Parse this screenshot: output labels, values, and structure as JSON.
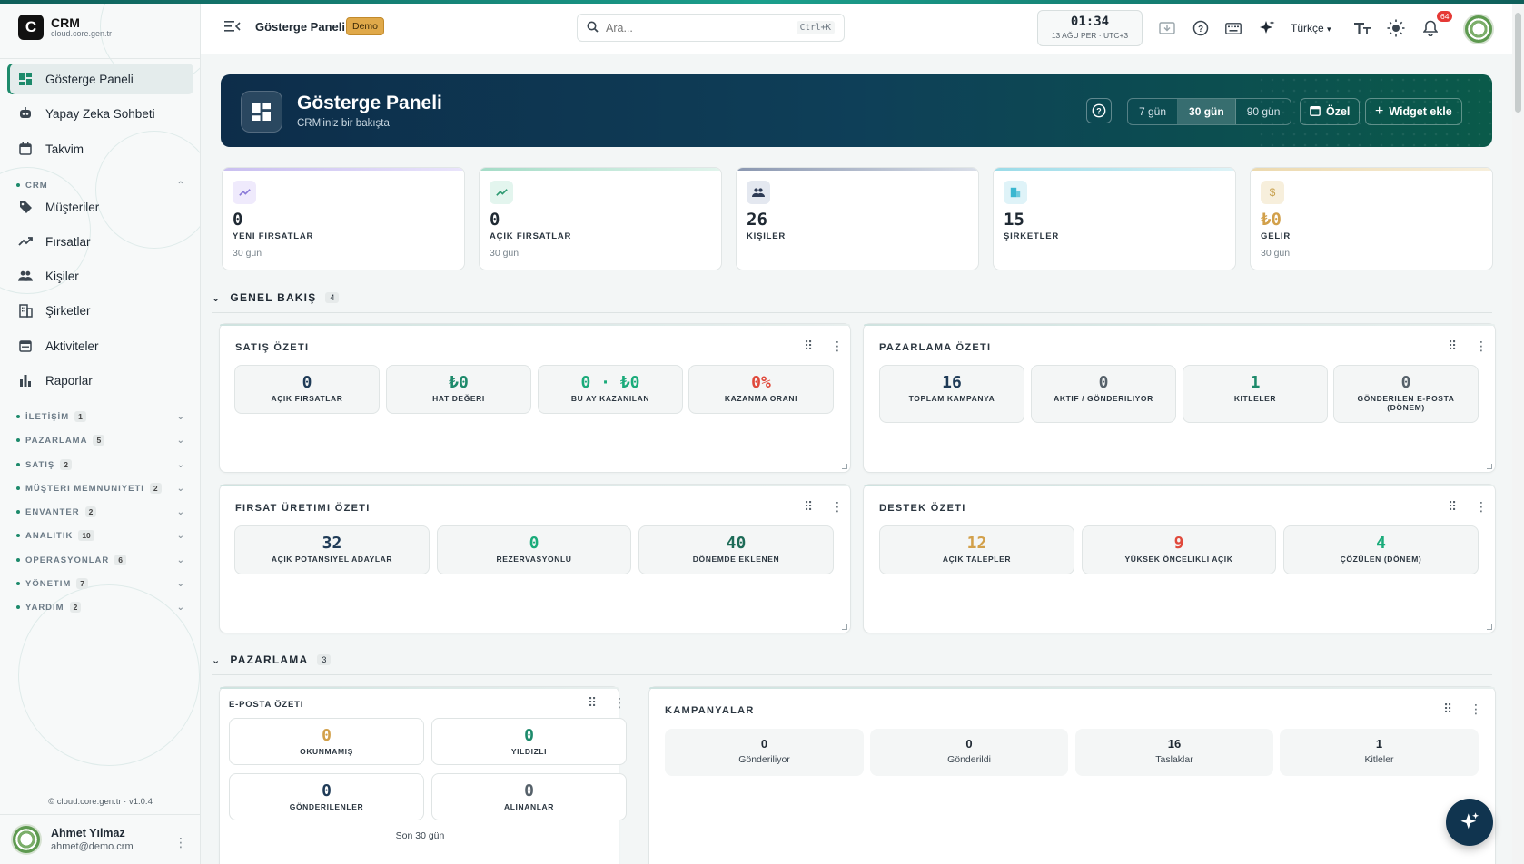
{
  "brand": {
    "title": "CRM",
    "subtitle": "cloud.core.gen.tr",
    "logo_letter": "C"
  },
  "sidebar": {
    "items": [
      {
        "label": "Gösterge Paneli",
        "icon": "dashboard-icon",
        "active": true
      },
      {
        "label": "Yapay Zeka Sohbeti",
        "icon": "robot-icon"
      },
      {
        "label": "Takvim",
        "icon": "calendar-icon"
      }
    ],
    "crm_group": {
      "label": "CRM"
    },
    "crm_items": [
      {
        "label": "Müşteriler",
        "icon": "tag-icon"
      },
      {
        "label": "Fırsatlar",
        "icon": "trend-icon"
      },
      {
        "label": "Kişiler",
        "icon": "people-icon"
      },
      {
        "label": "Şirketler",
        "icon": "building-icon"
      },
      {
        "label": "Aktiviteler",
        "icon": "calendar-check-icon"
      },
      {
        "label": "Raporlar",
        "icon": "bar-chart-icon"
      }
    ],
    "groups": [
      {
        "label": "İLETİŞİM",
        "count": "1"
      },
      {
        "label": "PAZARLAMA",
        "count": "5"
      },
      {
        "label": "SATIŞ",
        "count": "2"
      },
      {
        "label": "MÜŞTERI MEMNUNIYETI",
        "count": "2"
      },
      {
        "label": "ENVANTER",
        "count": "2"
      },
      {
        "label": "ANALITIK",
        "count": "10"
      },
      {
        "label": "OPERASYONLAR",
        "count": "6"
      },
      {
        "label": "YÖNETIM",
        "count": "7"
      },
      {
        "label": "YARDIM",
        "count": "2"
      }
    ],
    "copyright": "© cloud.core.gen.tr · v1.0.4",
    "user": {
      "name": "Ahmet Yılmaz",
      "email": "ahmet@demo.crm"
    }
  },
  "topbar": {
    "title": "Gösterge Paneli",
    "badge": "Demo",
    "search_placeholder": "Ara...",
    "search_shortcut": "Ctrl+K",
    "clock_time": "01:34",
    "clock_date": "13 AĞU PER · UTC+3",
    "language": "Türkçe",
    "notifications": "64"
  },
  "hero": {
    "title": "Gösterge Paneli",
    "subtitle": "CRM'iniz bir bakışta",
    "ranges": [
      "7 gün",
      "30 gün",
      "90 gün"
    ],
    "active_range": "30 gün",
    "custom_label": "Özel",
    "add_widget_label": "Widget ekle"
  },
  "kpis": [
    {
      "value": "0",
      "label": "YENI FIRSATLAR",
      "sub": "30 gün",
      "color": "#8b7bd8"
    },
    {
      "value": "0",
      "label": "AÇIK FIRSATLAR",
      "sub": "30 gün",
      "color": "#4caf8a"
    },
    {
      "value": "26",
      "label": "KIŞILER",
      "sub": "",
      "color": "#3b4a6b"
    },
    {
      "value": "15",
      "label": "ŞIRKETLER",
      "sub": "",
      "color": "#3bb7d0"
    },
    {
      "value": "₺0",
      "label": "GELIR",
      "sub": "30 gün",
      "color": "#d6b36a"
    }
  ],
  "sections": {
    "overview": {
      "label": "GENEL BAKIŞ",
      "count": "4"
    },
    "marketing": {
      "label": "PAZARLAMA",
      "count": "3"
    }
  },
  "sales_summary": {
    "title": "SATIŞ ÖZETI",
    "tiles": [
      {
        "value": "0",
        "label": "AÇIK FIRSATLAR",
        "color": "#1f3b57"
      },
      {
        "value": "₺0",
        "label": "HAT DEĞERI",
        "color": "#1d8a6b"
      },
      {
        "value": "0 · ₺0",
        "label": "BU AY KAZANILAN",
        "color": "#1aab7a"
      },
      {
        "value": "0%",
        "label": "KAZANMA ORANI",
        "color": "#e0493b"
      }
    ]
  },
  "marketing_summary": {
    "title": "PAZARLAMA ÖZETI",
    "tiles": [
      {
        "value": "16",
        "label": "TOPLAM KAMPANYA",
        "color": "#1f3b57"
      },
      {
        "value": "0",
        "label": "AKTIF / GÖNDERILIYOR",
        "color": "#56616a"
      },
      {
        "value": "1",
        "label": "KITLELER",
        "color": "#1d8a6b"
      },
      {
        "value": "0",
        "label": "GÖNDERILEN E-POSTA (DÖNEM)",
        "color": "#56616a"
      }
    ]
  },
  "lead_summary": {
    "title": "FIRSAT ÜRETIMI ÖZETI",
    "tiles": [
      {
        "value": "32",
        "label": "AÇIK POTANSIYEL ADAYLAR",
        "color": "#1f3b57"
      },
      {
        "value": "0",
        "label": "REZERVASYONLU",
        "color": "#1aab7a"
      },
      {
        "value": "40",
        "label": "DÖNEMDE EKLENEN",
        "color": "#1d6b57"
      }
    ]
  },
  "support_summary": {
    "title": "DESTEK ÖZETI",
    "tiles": [
      {
        "value": "12",
        "label": "AÇIK TALEPLER",
        "color": "#d2a04a"
      },
      {
        "value": "9",
        "label": "YÜKSEK ÖNCELIKLI AÇIK",
        "color": "#e0493b"
      },
      {
        "value": "4",
        "label": "ÇÖZÜLEN (DÖNEM)",
        "color": "#1aab7a"
      }
    ]
  },
  "email_summary": {
    "title": "E-POSTA ÖZETI",
    "tiles": [
      {
        "value": "0",
        "label": "OKUNMAMIŞ",
        "color": "#d2a04a"
      },
      {
        "value": "0",
        "label": "YILDIZLI",
        "color": "#1d8a6b"
      },
      {
        "value": "0",
        "label": "GÖNDERILENLER",
        "color": "#1f3b57"
      },
      {
        "value": "0",
        "label": "ALINANLAR",
        "color": "#56616a"
      }
    ],
    "footer": "Son 30 gün"
  },
  "campaigns": {
    "title": "KAMPANYALAR",
    "tiles": [
      {
        "value": "0",
        "label": "Gönderiliyor"
      },
      {
        "value": "0",
        "label": "Gönderildi"
      },
      {
        "value": "16",
        "label": "Taslaklar"
      },
      {
        "value": "1",
        "label": "Kitleler"
      }
    ]
  }
}
